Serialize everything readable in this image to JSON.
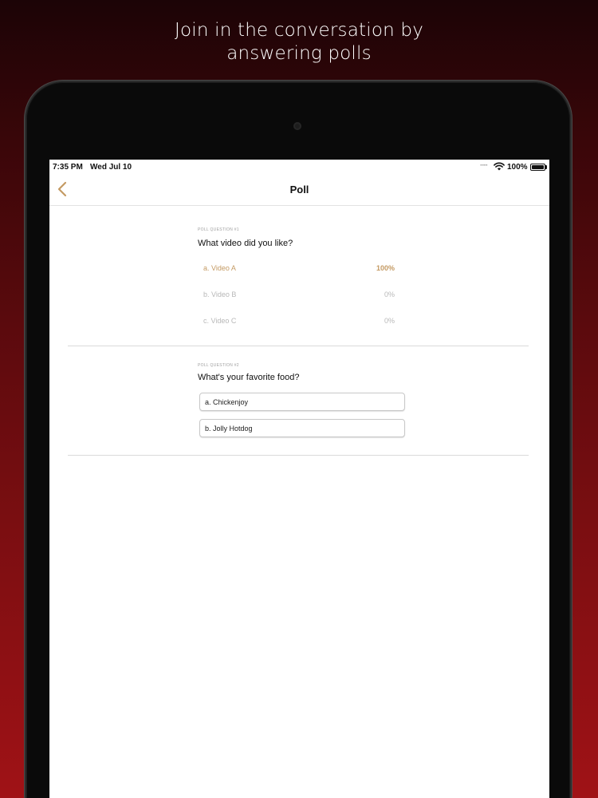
{
  "promo": {
    "line1": "Join in the conversation by",
    "line2": "answering polls"
  },
  "status_bar": {
    "time": "7:35 PM",
    "date": "Wed Jul 10",
    "battery": "100%"
  },
  "nav": {
    "title": "Poll",
    "back_icon": "chevron-left-icon",
    "accent": "#c49a63"
  },
  "polls": [
    {
      "caption": "POLL QUESTION #1",
      "question": "What video did you like?",
      "results": [
        {
          "label": "a. Video A",
          "percent": "100%"
        },
        {
          "label": "b. Video B",
          "percent": "0%"
        },
        {
          "label": "c. Video C",
          "percent": "0%"
        }
      ]
    },
    {
      "caption": "POLL QUESTION #2",
      "question": "What's your favorite food?",
      "options": [
        {
          "label": "a. Chickenjoy"
        },
        {
          "label": "b. Jolly Hotdog"
        }
      ]
    }
  ]
}
